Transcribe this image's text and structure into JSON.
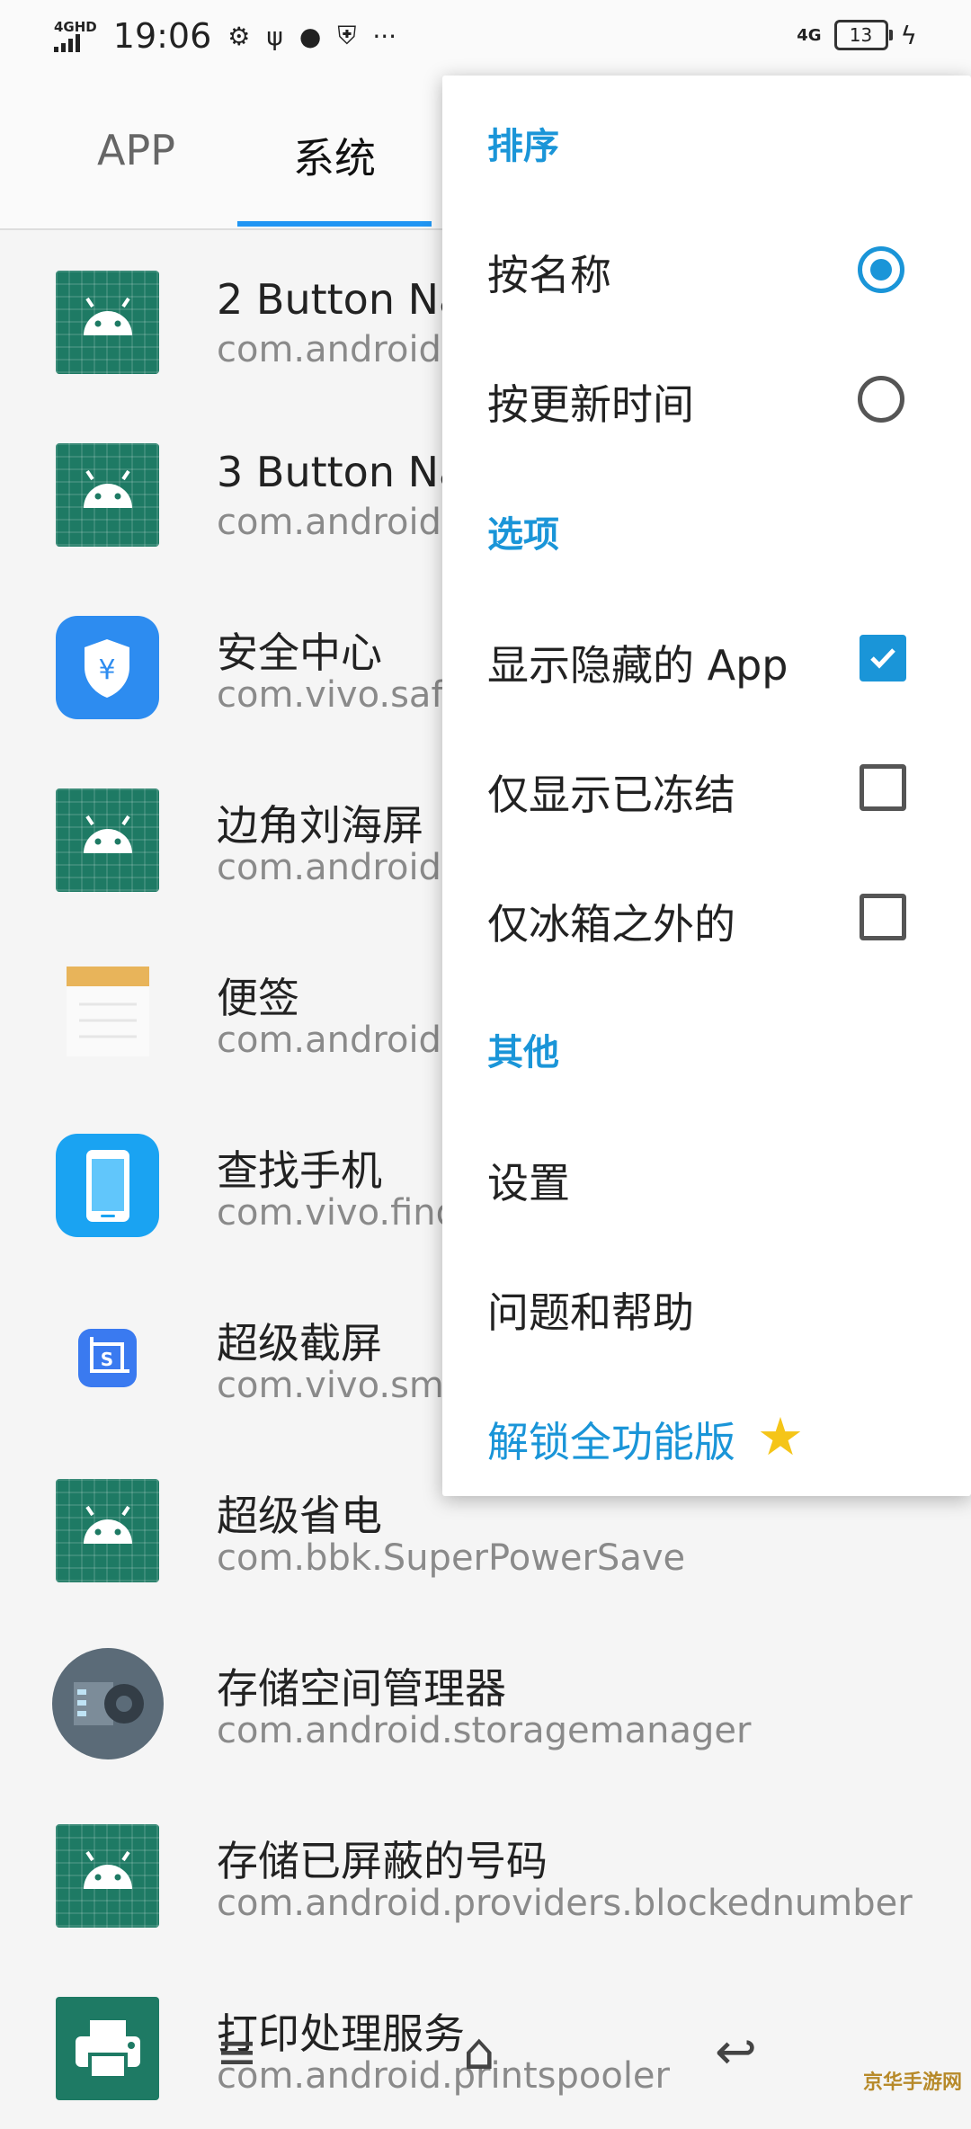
{
  "status_bar": {
    "network": "4GHD",
    "time": "19:06",
    "right_network": "4G",
    "battery": "13"
  },
  "tabs": [
    {
      "label": "APP"
    },
    {
      "label": "系统"
    }
  ],
  "apps": [
    {
      "name": "2 Button Na",
      "package": "com.android",
      "icon": "android-robot-icon"
    },
    {
      "name": "3 Button Na",
      "package": "com.android",
      "icon": "android-robot-icon"
    },
    {
      "name": "安全中心",
      "package": "com.vivo.saf",
      "icon": "security-shield-icon"
    },
    {
      "name": "边角刘海屏",
      "package": "com.android",
      "icon": "android-robot-icon"
    },
    {
      "name": "便签",
      "package": "com.android",
      "icon": "notes-icon"
    },
    {
      "name": "查找手机",
      "package": "com.vivo.find",
      "icon": "find-phone-icon"
    },
    {
      "name": "超级截屏",
      "package": "com.vivo.sm",
      "icon": "screenshot-icon"
    },
    {
      "name": "超级省电",
      "package": "com.bbk.SuperPowerSave",
      "icon": "android-robot-icon"
    },
    {
      "name": "存储空间管理器",
      "package": "com.android.storagemanager",
      "icon": "storage-gear-icon"
    },
    {
      "name": "存储已屏蔽的号码",
      "package": "com.android.providers.blockednumber",
      "icon": "android-robot-icon"
    },
    {
      "name": "打印处理服务",
      "package": "com.android.printspooler",
      "icon": "printer-icon"
    }
  ],
  "menu": {
    "sort_header": "排序",
    "sort_by_name": "按名称",
    "sort_by_update": "按更新时间",
    "sort_selected": "by_name",
    "options_header": "选项",
    "show_hidden": "显示隐藏的 App",
    "show_hidden_checked": true,
    "only_frozen": "仅显示已冻结",
    "only_frozen_checked": false,
    "outside_fridge": "仅冰箱之外的",
    "outside_fridge_checked": false,
    "other_header": "其他",
    "settings": "设置",
    "help": "问题和帮助",
    "unlock": "解锁全功能版"
  },
  "watermark": "京华手游网",
  "colors": {
    "accent": "#1a95d8",
    "android_icon_bg": "#1e7a64",
    "background": "#f5f5f5"
  }
}
